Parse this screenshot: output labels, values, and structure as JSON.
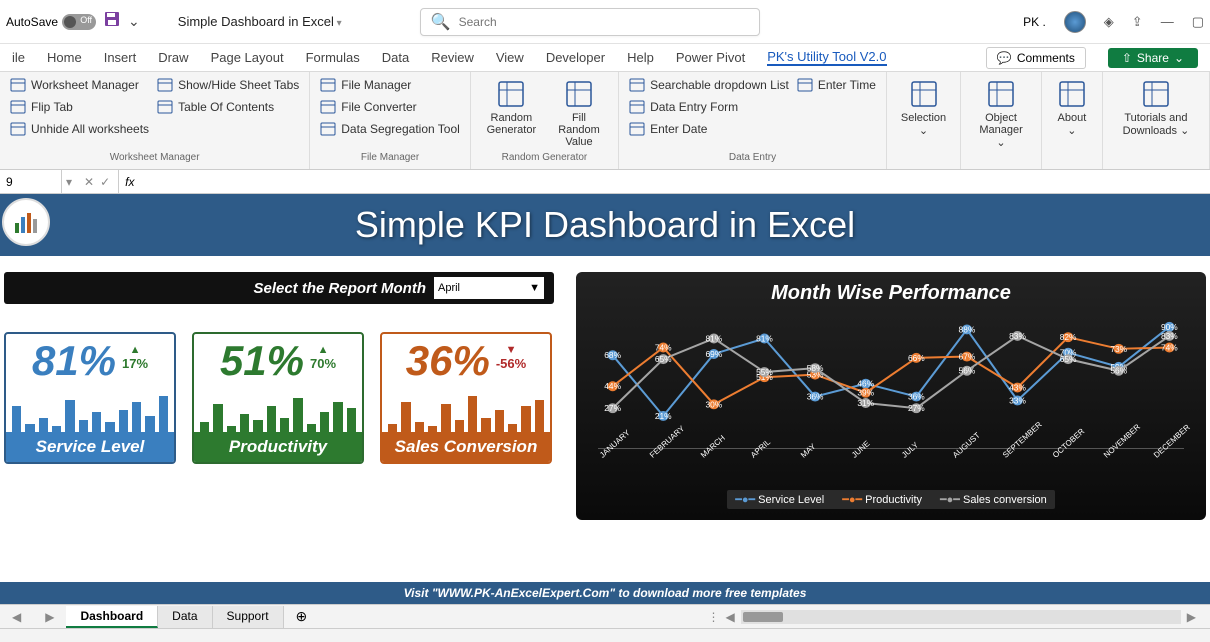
{
  "titlebar": {
    "autosave": "AutoSave",
    "toggle": "Off",
    "file_title": "Simple Dashboard in Excel",
    "search_placeholder": "Search",
    "user_label": "PK ."
  },
  "menu": {
    "tabs": [
      "ile",
      "Home",
      "Insert",
      "Draw",
      "Page Layout",
      "Formulas",
      "Data",
      "Review",
      "View",
      "Developer",
      "Help",
      "Power Pivot",
      "PK's Utility Tool V2.0"
    ],
    "active_index": 12,
    "comments": "Comments",
    "share": "Share"
  },
  "ribbon": {
    "groups": [
      {
        "label": "Worksheet Manager",
        "columns": [
          [
            "Worksheet Manager",
            "Flip Tab",
            "Unhide All worksheets"
          ],
          [
            "Show/Hide Sheet Tabs",
            "Table Of Contents"
          ]
        ]
      },
      {
        "label": "File Manager",
        "columns": [
          [
            "File Manager",
            "File Converter",
            "Data Segregation Tool"
          ]
        ]
      },
      {
        "label": "Random Generator",
        "big": [
          "Random Generator",
          "Fill Random Value"
        ]
      },
      {
        "label": "Data Entry",
        "columns": [
          [
            "Searchable dropdown List",
            "Data Entry Form",
            "Enter Date"
          ],
          [
            "Enter Time"
          ]
        ]
      },
      {
        "label": "",
        "big": [
          "Selection"
        ],
        "chev": true
      },
      {
        "label": "",
        "big": [
          "Object Manager"
        ],
        "chev": true
      },
      {
        "label": "",
        "big": [
          "About"
        ],
        "chev": true
      },
      {
        "label": "",
        "big": [
          "Tutorials and Downloads"
        ],
        "chev": true
      }
    ]
  },
  "formulabar": {
    "namebox": "9",
    "fx": "fx"
  },
  "dashboard": {
    "title": "Simple KPI Dashboard in Excel",
    "select_label": "Select the Report Month",
    "selected_month": "April",
    "kpis": [
      {
        "value": "81%",
        "delta": "17%",
        "dir": "up",
        "label": "Service Level",
        "bars": [
          26,
          8,
          14,
          6,
          32,
          12,
          20,
          10,
          22,
          30,
          16,
          36
        ]
      },
      {
        "value": "51%",
        "delta": "70%",
        "dir": "up",
        "label": "Productivity",
        "bars": [
          10,
          28,
          6,
          18,
          12,
          26,
          14,
          34,
          8,
          20,
          30,
          24
        ]
      },
      {
        "value": "36%",
        "delta": "-56%",
        "dir": "down",
        "label": "Sales Conversion",
        "bars": [
          8,
          30,
          10,
          6,
          28,
          12,
          36,
          14,
          22,
          8,
          26,
          32
        ]
      }
    ],
    "footer": "Visit \"WWW.PK-AnExcelExpert.Com\" to download more free templates"
  },
  "chart_data": {
    "type": "line",
    "title": "Month Wise Performance",
    "categories": [
      "JANUARY",
      "FEBRUARY",
      "MARCH",
      "APRIL",
      "MAY",
      "JUNE",
      "JULY",
      "AUGUST",
      "SEPTEMBER",
      "OCTOBER",
      "NOVEMBER",
      "DECEMBER"
    ],
    "series": [
      {
        "name": "Service Level",
        "color": "#5b9bd5",
        "values": [
          68,
          21,
          69,
          81,
          36,
          46,
          36,
          88,
          33,
          70,
          59,
          90
        ]
      },
      {
        "name": "Productivity",
        "color": "#ed7d31",
        "values": [
          44,
          74,
          30,
          51,
          53,
          39,
          66,
          67,
          43,
          82,
          73,
          74
        ]
      },
      {
        "name": "Sales conversion",
        "color": "#a5a5a5",
        "values": [
          27,
          65,
          81,
          55,
          58,
          31,
          27,
          56,
          83,
          65,
          56,
          83
        ]
      }
    ],
    "xlabel": "",
    "ylabel": "",
    "ylim": [
      0,
      100
    ],
    "extra_labels": [
      "36%"
    ]
  },
  "sheets": {
    "tabs": [
      "Dashboard",
      "Data",
      "Support"
    ],
    "active_index": 0
  }
}
